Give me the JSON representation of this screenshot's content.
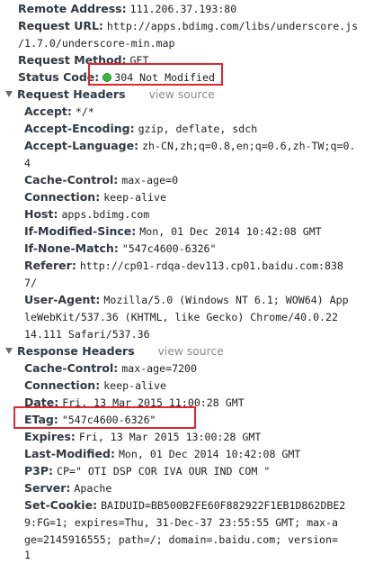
{
  "general": {
    "remote_address": {
      "key": "Remote Address:",
      "value": "111.206.37.193:80"
    },
    "request_url": {
      "key": "Request URL:",
      "value_1": "http://apps.bdimg.com/libs/underscore.js",
      "value_2": "/1.7.0/underscore-min.map"
    },
    "request_method": {
      "key": "Request Method:",
      "value": "GET"
    },
    "status_code": {
      "key": "Status Code:",
      "value": "304 Not Modified",
      "status_color": "#36b736"
    }
  },
  "request_headers": {
    "title": "Request Headers",
    "view_source": "view source",
    "accept": {
      "key": "Accept:",
      "value": "*/*"
    },
    "accept_encoding": {
      "key": "Accept-Encoding:",
      "value": "gzip, deflate, sdch"
    },
    "accept_language": {
      "key": "Accept-Language:",
      "value_1": "zh-CN,zh;q=0.8,en;q=0.6,zh-TW;q=0.",
      "value_2": "4"
    },
    "cache_control": {
      "key": "Cache-Control:",
      "value": "max-age=0"
    },
    "connection": {
      "key": "Connection:",
      "value": "keep-alive"
    },
    "host": {
      "key": "Host:",
      "value": "apps.bdimg.com"
    },
    "if_modified_since": {
      "key": "If-Modified-Since:",
      "value": "Mon, 01 Dec 2014 10:42:08 GMT"
    },
    "if_none_match": {
      "key": "If-None-Match:",
      "value": "\"547c4600-6326\""
    },
    "referer": {
      "key": "Referer:",
      "value_1": "http://cp01-rdqa-dev113.cp01.baidu.com:838",
      "value_2": "7/"
    },
    "user_agent": {
      "key": "User-Agent:",
      "value_1": "Mozilla/5.0 (Windows NT 6.1; WOW64) App",
      "value_2": "leWebKit/537.36 (KHTML, like Gecko) Chrome/40.0.22",
      "value_3": "14.111 Safari/537.36"
    }
  },
  "response_headers": {
    "title": "Response Headers",
    "view_source": "view source",
    "cache_control": {
      "key": "Cache-Control:",
      "value": "max-age=7200"
    },
    "connection": {
      "key": "Connection:",
      "value": "keep-alive"
    },
    "date": {
      "key": "Date:",
      "value": "Fri, 13 Mar 2015 11:00:28 GMT"
    },
    "etag": {
      "key": "ETag:",
      "value": "\"547c4600-6326\""
    },
    "expires": {
      "key": "Expires:",
      "value": "Fri, 13 Mar 2015 13:00:28 GMT"
    },
    "last_modified": {
      "key": "Last-Modified:",
      "value": "Mon, 01 Dec 2014 10:42:08 GMT"
    },
    "p3p": {
      "key": "P3P:",
      "value": "CP=\" OTI DSP COR IVA OUR IND COM \""
    },
    "server": {
      "key": "Server:",
      "value": "Apache"
    },
    "set_cookie": {
      "key": "Set-Cookie:",
      "value_1": "BAIDUID=BB500B2FE60F882922F1EB1D862DBE2",
      "value_2": "9:FG=1; expires=Thu, 31-Dec-37 23:55:55 GMT; max-a",
      "value_3": "ge=2145916555; path=/; domain=.baidu.com; version=",
      "value_4": "1"
    }
  },
  "highlight_color": "#e2262e"
}
